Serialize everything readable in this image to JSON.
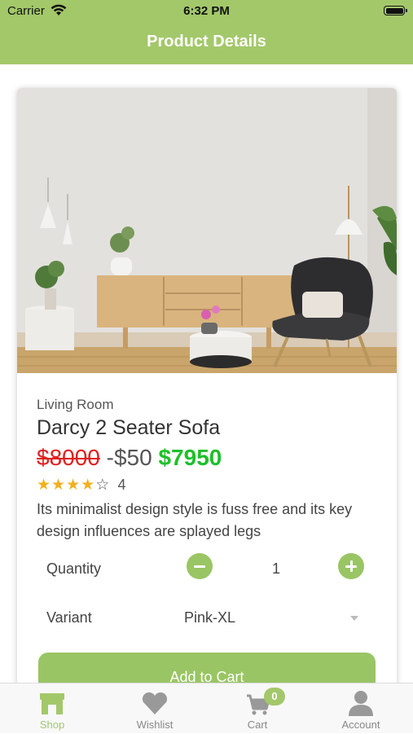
{
  "status_bar": {
    "carrier": "Carrier",
    "time": "6:32 PM",
    "icons": [
      "wifi-icon",
      "battery-icon"
    ]
  },
  "header": {
    "title": "Product Details",
    "background": "#a3c86a"
  },
  "product": {
    "category": "Living Room",
    "name": "Darcy 2 Seater Sofa",
    "original_price": "$8000",
    "discount": "-$50",
    "final_price": "$7950",
    "rating": 4,
    "max_rating": 5,
    "rating_count": "4",
    "description": "Its minimalist design style is fuss free and its key design influences are splayed legs"
  },
  "quantity": {
    "label": "Quantity",
    "value": "1"
  },
  "variant": {
    "label": "Variant",
    "selected": "Pink-XL"
  },
  "add_to_cart": {
    "label": "Add to Cart"
  },
  "tabbar": {
    "items": [
      {
        "label": "Shop",
        "icon": "shop-icon",
        "active": true
      },
      {
        "label": "Wishlist",
        "icon": "heart-icon",
        "active": false
      },
      {
        "label": "Cart",
        "icon": "cart-icon",
        "active": false
      },
      {
        "label": "Account",
        "icon": "account-icon",
        "active": false
      }
    ],
    "cart_badge": "0"
  },
  "colors": {
    "accent": "#a3c86a",
    "button": "#99c564",
    "old_price": "#e02020",
    "new_price": "#1fbf2a",
    "star": "#f2b01e"
  }
}
